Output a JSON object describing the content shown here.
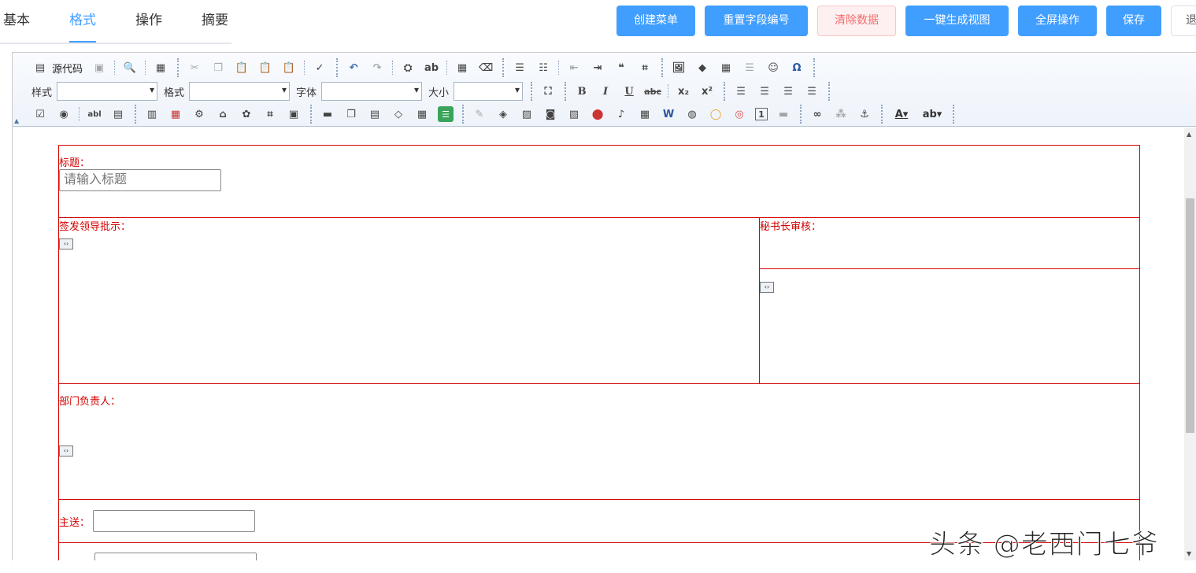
{
  "tabs": [
    {
      "label": "基本"
    },
    {
      "label": "格式",
      "active": true
    },
    {
      "label": "操作"
    },
    {
      "label": "摘要"
    }
  ],
  "actions": {
    "create_menu": "创建菜单",
    "reset_fields": "重置字段编号",
    "clear_data": "清除数据",
    "gen_view": "一键生成视图",
    "fullscreen": "全屏操作",
    "save": "保存",
    "exit": "退"
  },
  "toolbar": {
    "source": "源代码",
    "style_label": "样式",
    "format_label": "格式",
    "font_label": "字体",
    "size_label": "大小",
    "bold": "B",
    "italic": "I",
    "underline": "U",
    "strike": "abc",
    "subscript": "x₂",
    "superscript": "x²",
    "omega": "Ω"
  },
  "form": {
    "title_label": "标题：",
    "title_placeholder": "请输入标题",
    "approval_label": "签发领导批示：",
    "secretary_label": "秘书长审核：",
    "dept_label": "部门负责人：",
    "send_label": "主送："
  },
  "watermark": "头条 @老西门七爷",
  "colors": {
    "accent": "#409eff",
    "form_red": "#d40000"
  }
}
